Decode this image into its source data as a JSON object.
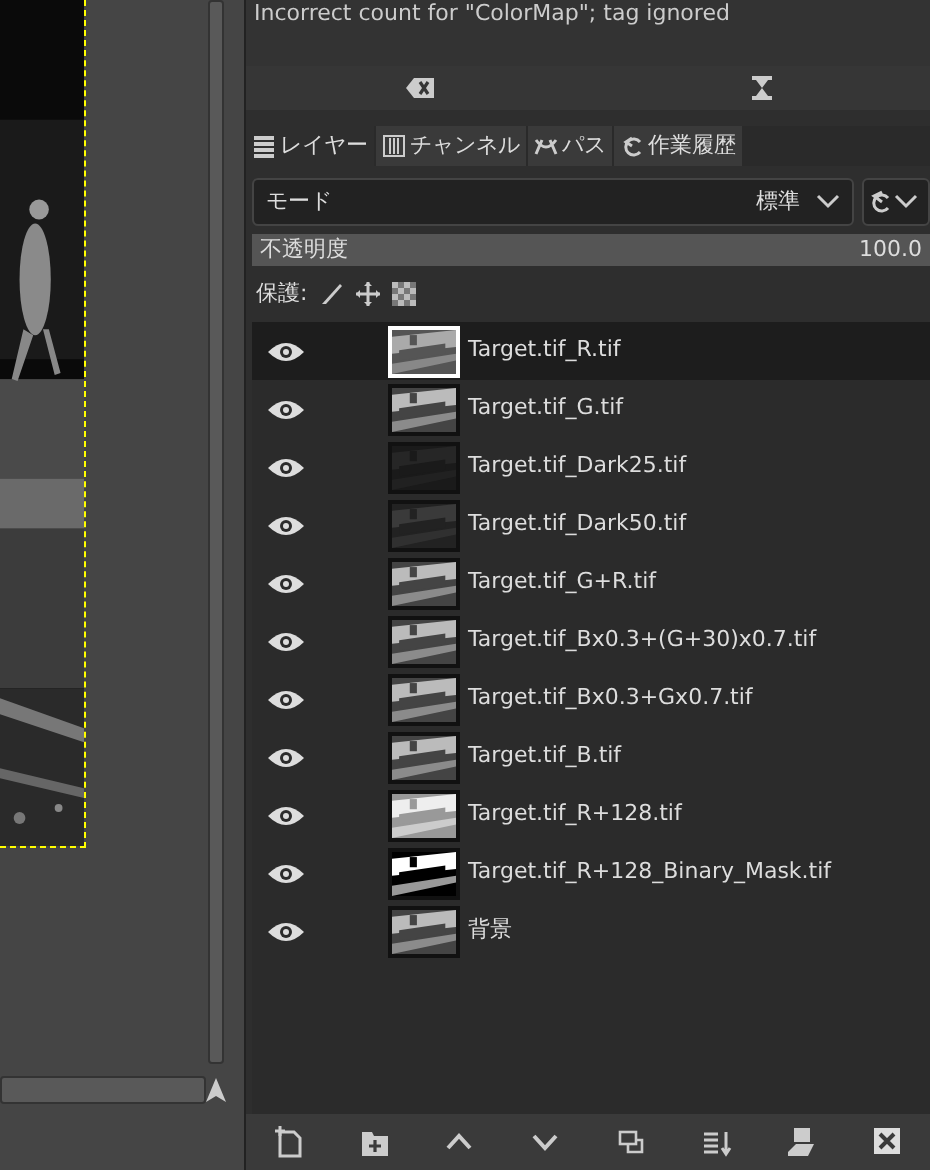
{
  "message_log": {
    "text": "Incorrect count for \"ColorMap\"; tag ignored"
  },
  "tabs": [
    {
      "label": "レイヤー",
      "selected": true,
      "kind": "layers"
    },
    {
      "label": "チャンネル",
      "selected": false,
      "kind": "channels"
    },
    {
      "label": "パス",
      "selected": false,
      "kind": "paths"
    },
    {
      "label": "作業履歴",
      "selected": false,
      "kind": "history"
    }
  ],
  "mode": {
    "label": "モード",
    "value": "標準"
  },
  "opacity": {
    "label": "不透明度",
    "value": "100.0",
    "level": 1
  },
  "lock": {
    "label": "保護:"
  },
  "layers": [
    {
      "name": "Target.tif_R.tif",
      "selected": true,
      "visible": true
    },
    {
      "name": "Target.tif_G.tif",
      "selected": false,
      "visible": true
    },
    {
      "name": "Target.tif_Dark25.tif",
      "selected": false,
      "visible": true
    },
    {
      "name": "Target.tif_Dark50.tif",
      "selected": false,
      "visible": true
    },
    {
      "name": "Target.tif_G+R.tif",
      "selected": false,
      "visible": true
    },
    {
      "name": "Target.tif_Bx0.3+(G+30)x0.7.tif",
      "selected": false,
      "visible": true
    },
    {
      "name": "Target.tif_Bx0.3+Gx0.7.tif",
      "selected": false,
      "visible": true
    },
    {
      "name": "Target.tif_B.tif",
      "selected": false,
      "visible": true
    },
    {
      "name": "Target.tif_R+128.tif",
      "selected": false,
      "visible": true
    },
    {
      "name": "Target.tif_R+128_Binary_Mask.tif",
      "selected": false,
      "visible": true
    },
    {
      "name": "背景",
      "selected": false,
      "visible": true
    }
  ]
}
